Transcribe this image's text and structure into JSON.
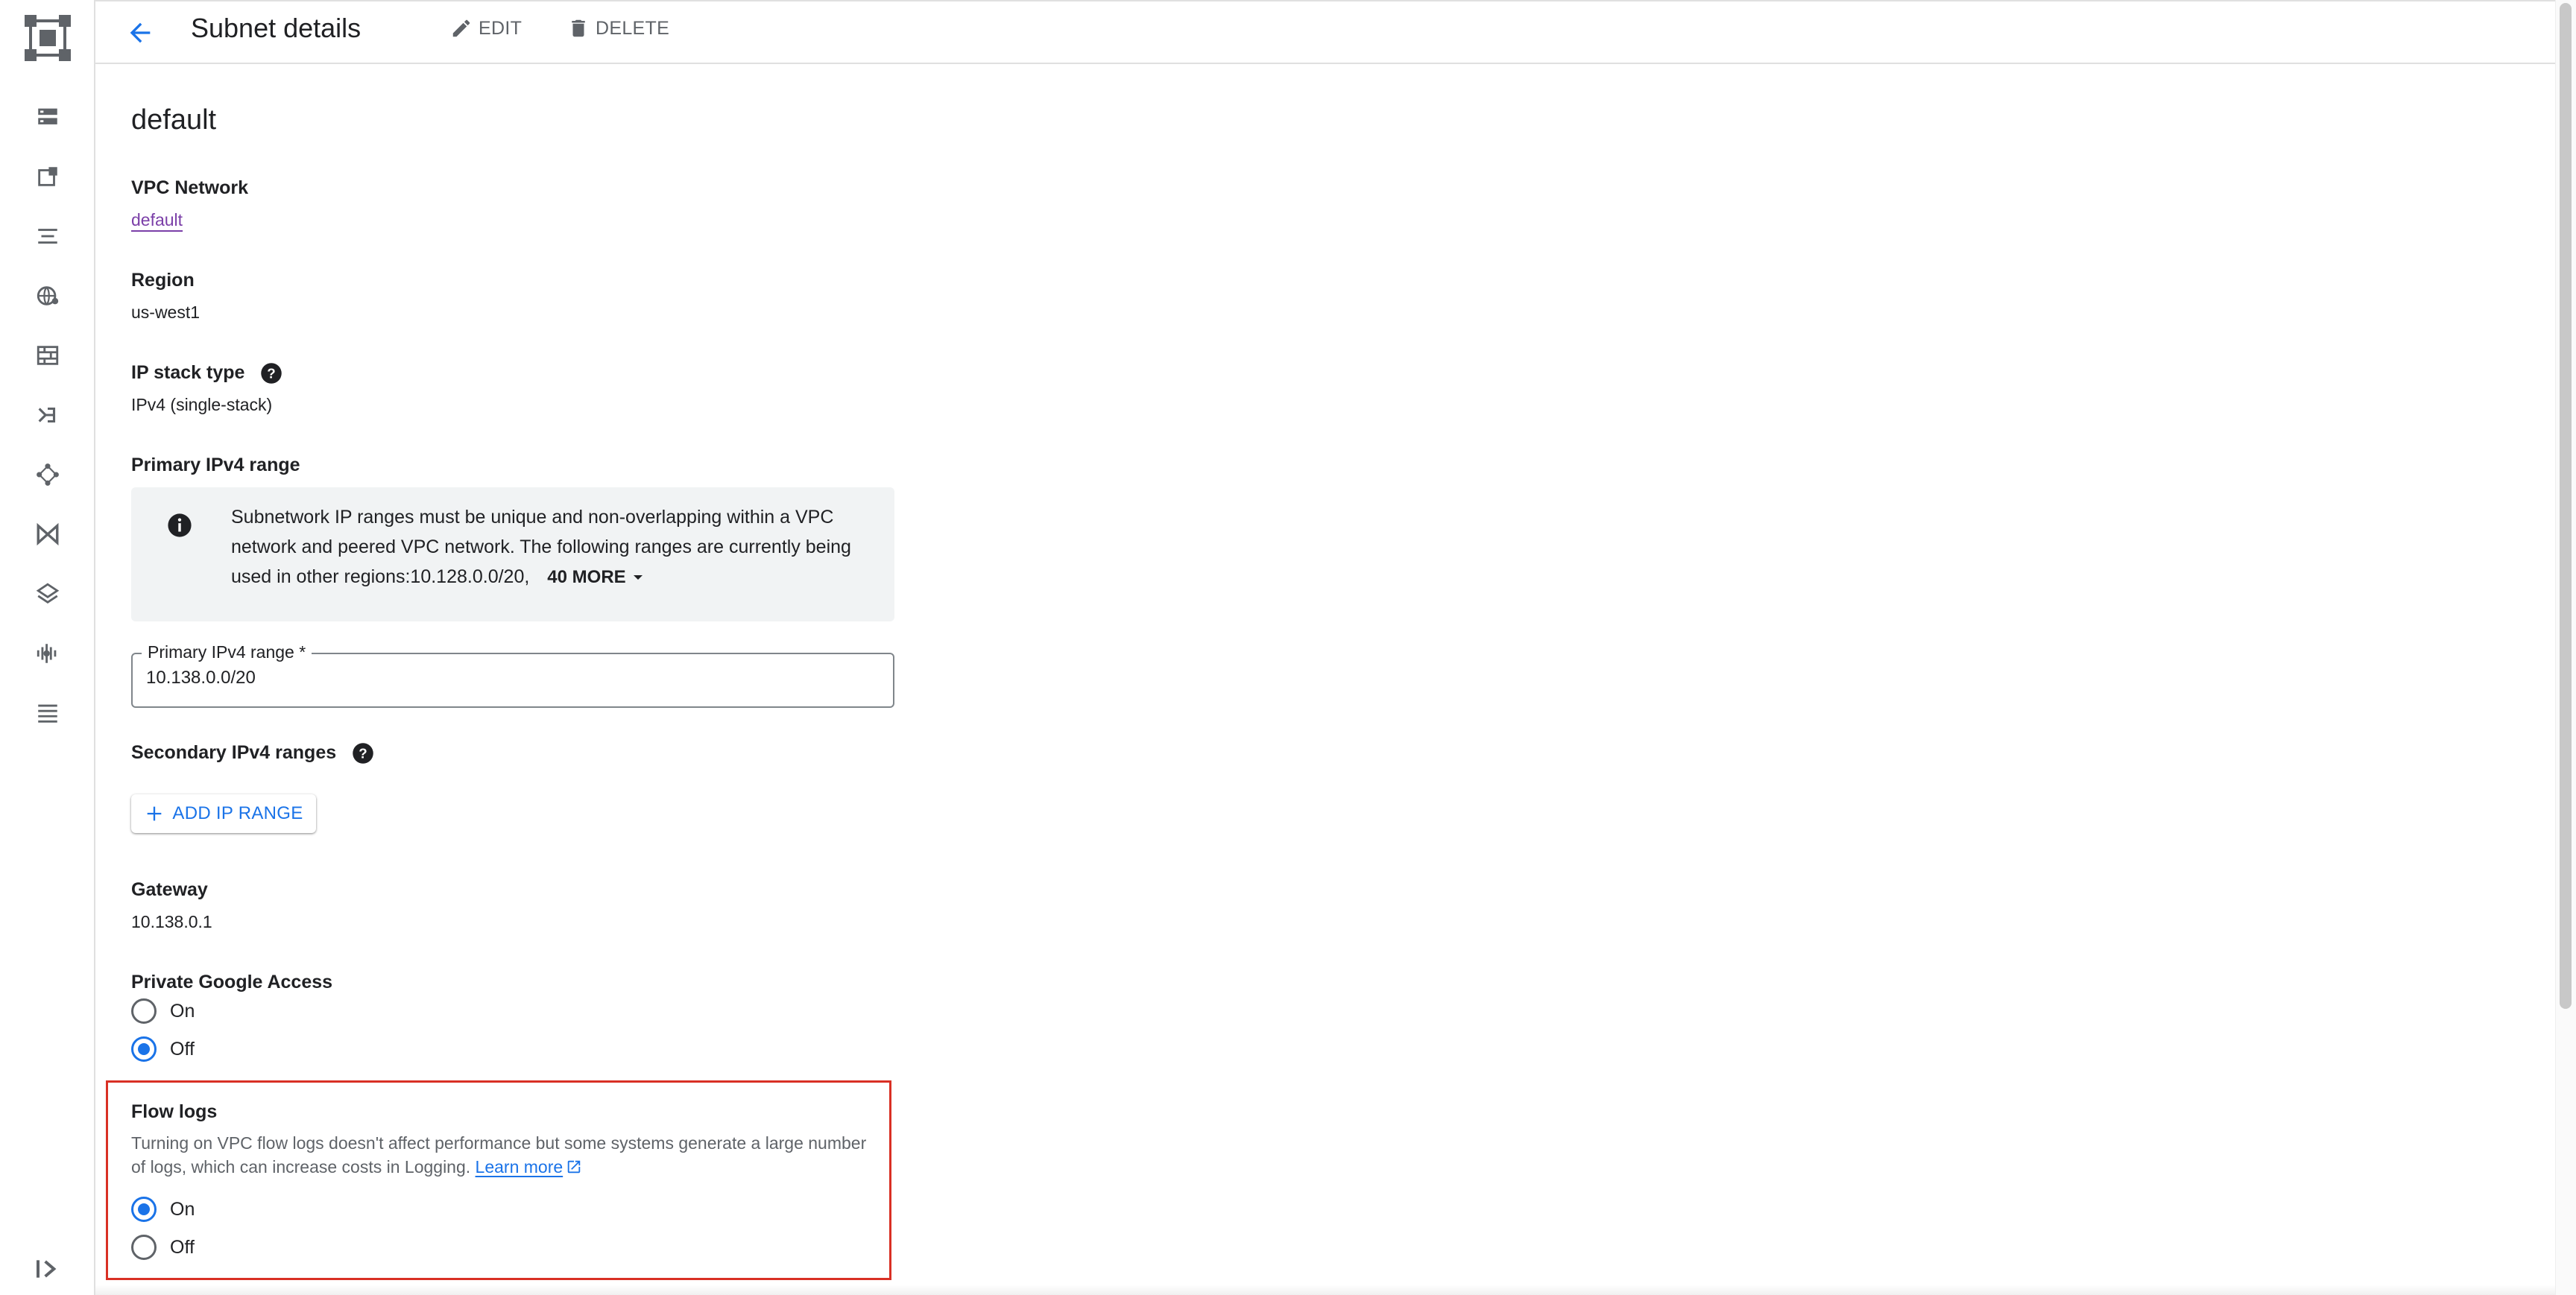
{
  "header": {
    "title": "Subnet details",
    "edit_label": "EDIT",
    "delete_label": "DELETE"
  },
  "subnet": {
    "name": "default",
    "vpc_network_label": "VPC Network",
    "vpc_network_value": "default",
    "region_label": "Region",
    "region_value": "us-west1",
    "ip_stack_label": "IP stack type",
    "ip_stack_value": "IPv4 (single-stack)",
    "primary_range_label": "Primary IPv4 range",
    "info_text": "Subnetwork IP ranges must be unique and non-overlapping within a VPC network and peered VPC network. The following ranges are currently being used in other regions:10.128.0.0/20,",
    "more_label": "40 MORE",
    "primary_range_field_label": "Primary IPv4 range *",
    "primary_range_field_value": "10.138.0.0/20",
    "secondary_ranges_label": "Secondary IPv4 ranges",
    "add_range_label": "ADD IP RANGE",
    "gateway_label": "Gateway",
    "gateway_value": "10.138.0.1",
    "private_access_label": "Private Google Access",
    "private_access_on": "On",
    "private_access_off": "Off",
    "private_access_selected": "Off",
    "flow_logs_label": "Flow logs",
    "flow_logs_desc": "Turning on VPC flow logs doesn't affect performance but some systems generate a large number of logs, which can increase costs in Logging.",
    "learn_more": "Learn more",
    "flow_logs_on": "On",
    "flow_logs_off": "Off",
    "flow_logs_selected": "On"
  },
  "nav": {
    "icons": [
      "dashboard-icon",
      "instances-icon",
      "list-icon",
      "globe-icon",
      "firewall-icon",
      "routes-icon",
      "network-topology-icon",
      "peering-icon",
      "layers-icon",
      "monitoring-icon",
      "logs-icon"
    ],
    "expand_icon": "expand-icon"
  },
  "colors": {
    "accent": "#1a73e8",
    "highlight_border": "#d93025",
    "link_visited": "#7b3fa8",
    "info_bg": "#f1f3f4"
  }
}
